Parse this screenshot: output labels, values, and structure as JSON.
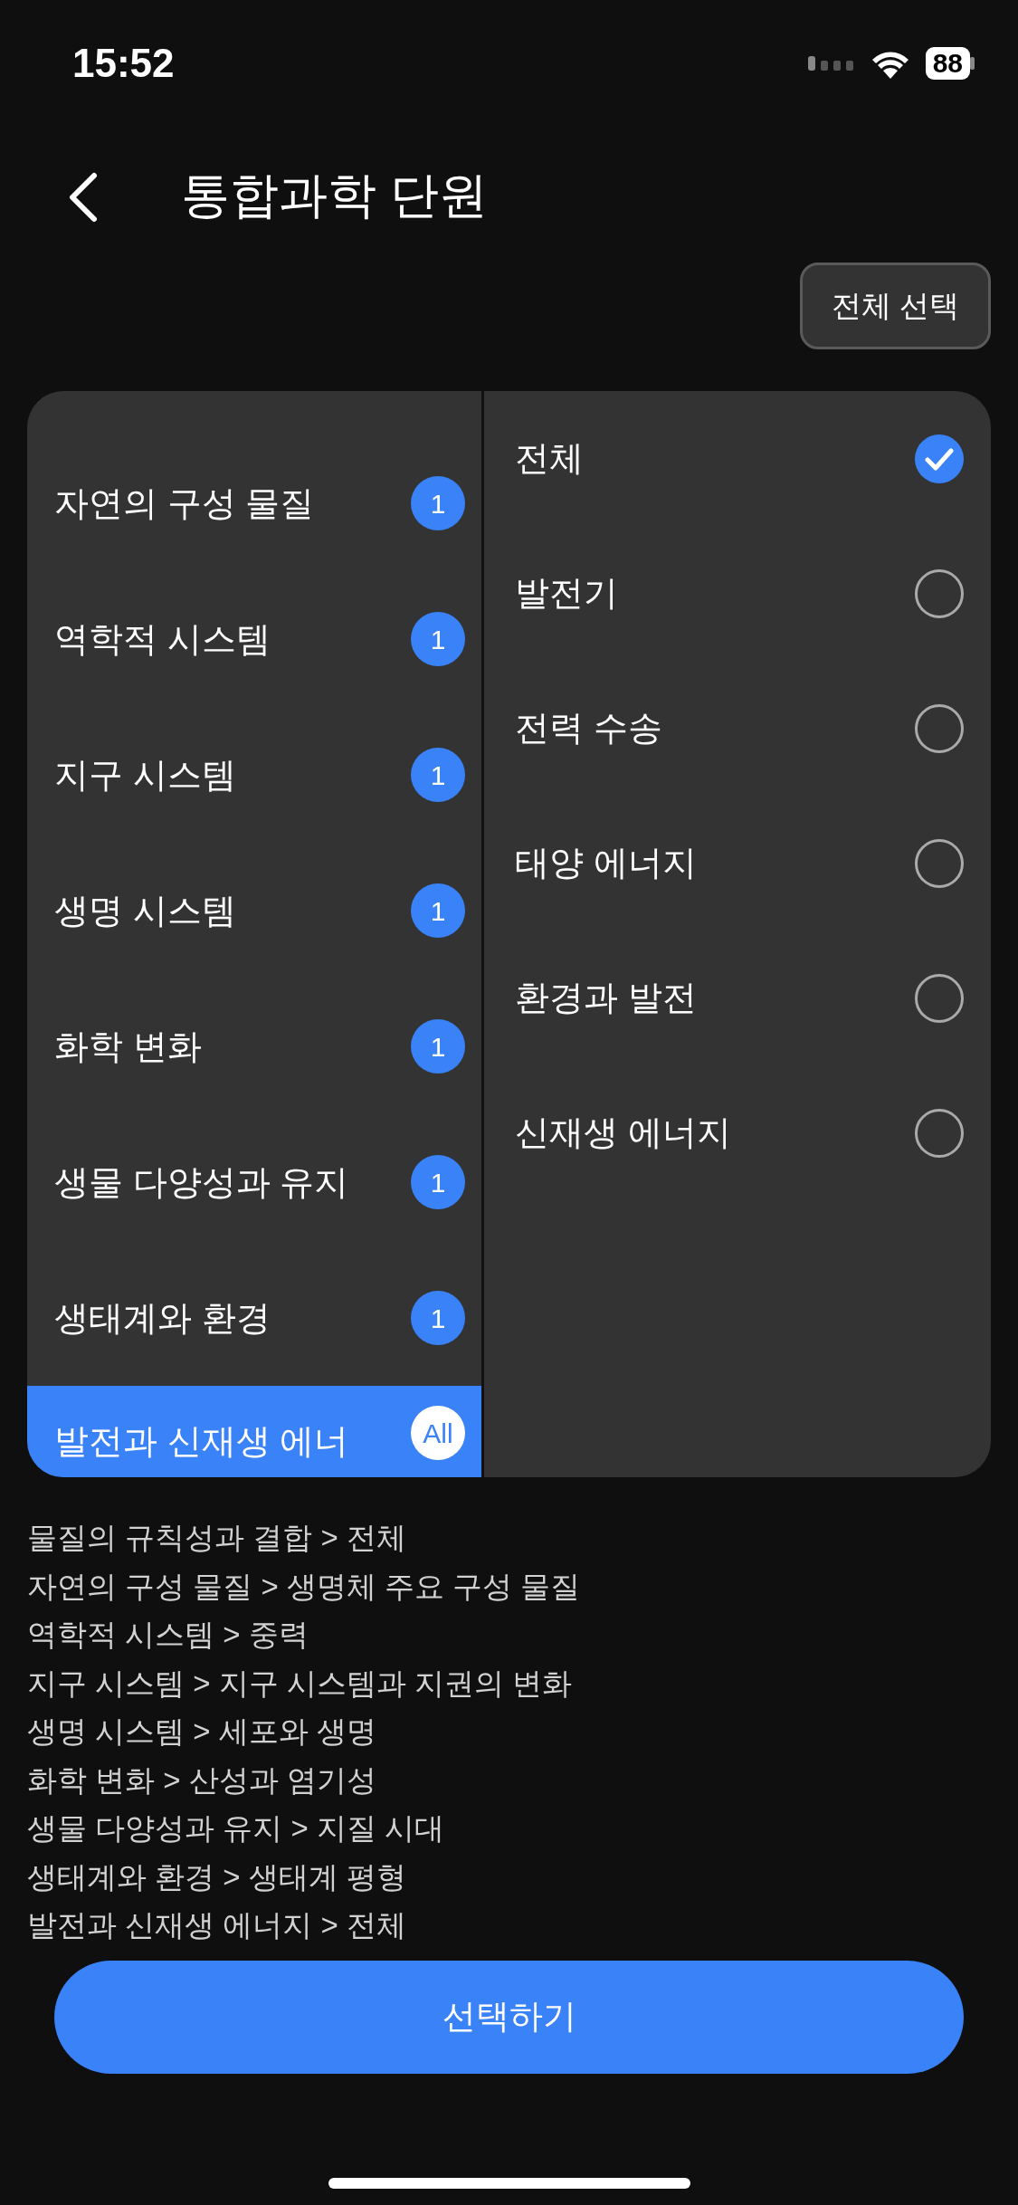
{
  "status_bar": {
    "time": "15:52",
    "battery": "88"
  },
  "header": {
    "title": "통합과학 단원"
  },
  "select_all_button": {
    "label": "전체 선택"
  },
  "categories": [
    {
      "label": "자연의 구성 물질",
      "badge": "1",
      "selected": false
    },
    {
      "label": "역학적 시스템",
      "badge": "1",
      "selected": false
    },
    {
      "label": "지구 시스템",
      "badge": "1",
      "selected": false
    },
    {
      "label": "생명 시스템",
      "badge": "1",
      "selected": false
    },
    {
      "label": "화학 변화",
      "badge": "1",
      "selected": false
    },
    {
      "label": "생물 다양성과 유지",
      "badge": "1",
      "selected": false
    },
    {
      "label": "생태계와 환경",
      "badge": "1",
      "selected": false
    },
    {
      "label": "발전과 신재생 에너",
      "badge": "All",
      "selected": true
    }
  ],
  "subcategories": [
    {
      "label": "전체",
      "checked": true
    },
    {
      "label": "발전기",
      "checked": false
    },
    {
      "label": "전력 수송",
      "checked": false
    },
    {
      "label": "태양 에너지",
      "checked": false
    },
    {
      "label": "환경과 발전",
      "checked": false
    },
    {
      "label": "신재생 에너지",
      "checked": false
    }
  ],
  "selection_summary": [
    "물질의 규칙성과 결합 > 전체",
    "자연의 구성 물질 > 생명체 주요 구성 물질",
    "역학적 시스템 > 중력",
    "지구 시스템 > 지구 시스템과 지권의 변화",
    "생명 시스템 > 세포와 생명",
    "화학 변화 > 산성과 염기성",
    "생물 다양성과 유지 > 지질 시대",
    "생태계와 환경 > 생태계 평형",
    "발전과 신재생 에너지 > 전체"
  ],
  "submit_button": {
    "label": "선택하기"
  }
}
